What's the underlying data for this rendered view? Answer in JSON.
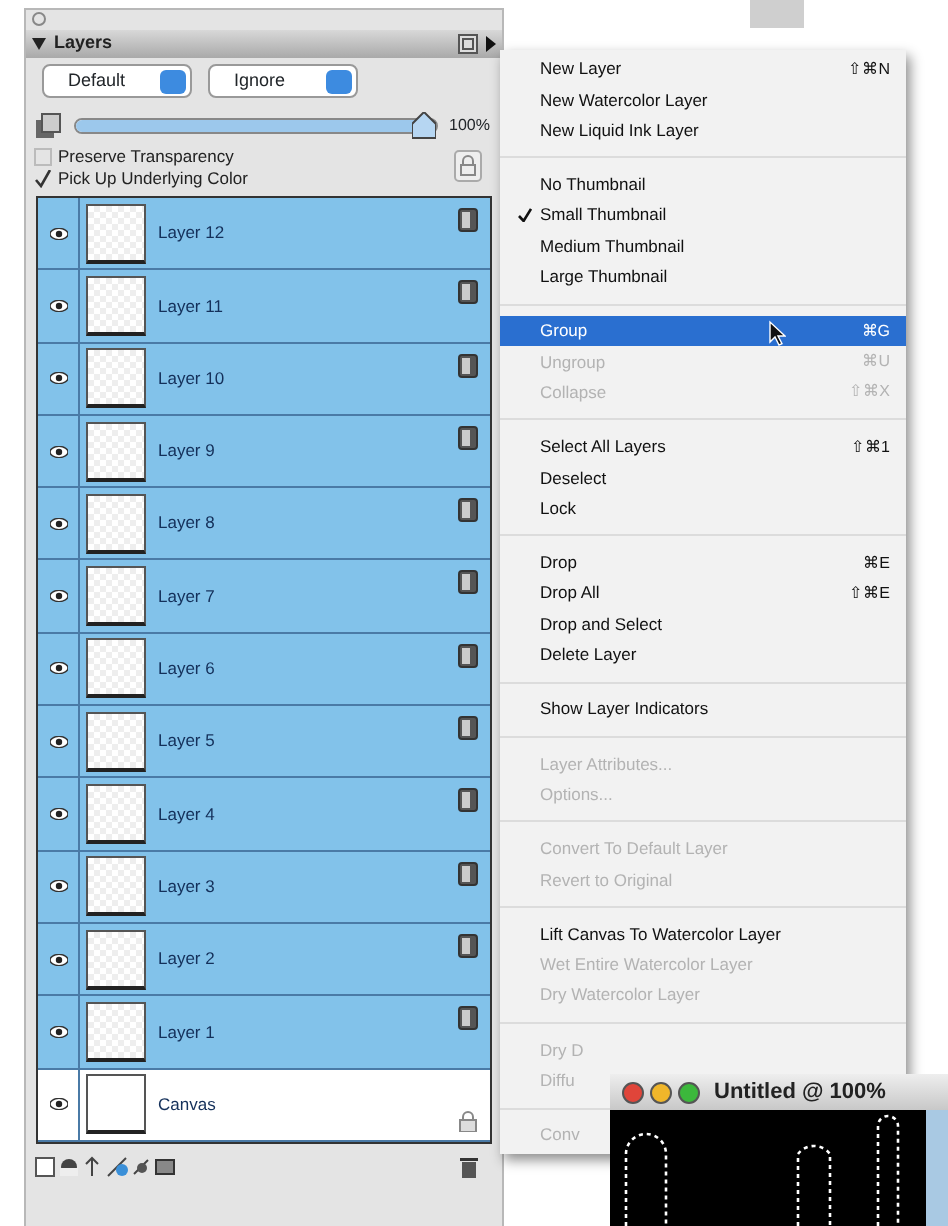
{
  "panel": {
    "title": "Layers",
    "composite_method": "Default",
    "depth": "Ignore",
    "opacity": {
      "level": 1,
      "reading": "100%"
    },
    "options": [
      {
        "label": "Preserve Transparency",
        "checked": false
      },
      {
        "label": "Pick Up Underlying Color",
        "checked": true
      }
    ],
    "layers": [
      {
        "name": "Layer 12",
        "kind": "layer",
        "selected": true,
        "visible": true
      },
      {
        "name": "Layer 11",
        "kind": "layer",
        "selected": true,
        "visible": true
      },
      {
        "name": "Layer 10",
        "kind": "layer",
        "selected": true,
        "visible": true
      },
      {
        "name": "Layer 9",
        "kind": "layer",
        "selected": true,
        "visible": true
      },
      {
        "name": "Layer 8",
        "kind": "layer",
        "selected": true,
        "visible": true
      },
      {
        "name": "Layer 7",
        "kind": "layer",
        "selected": true,
        "visible": true
      },
      {
        "name": "Layer 6",
        "kind": "layer",
        "selected": true,
        "visible": true
      },
      {
        "name": "Layer 5",
        "kind": "layer",
        "selected": true,
        "visible": true
      },
      {
        "name": "Layer 4",
        "kind": "layer",
        "selected": true,
        "visible": true
      },
      {
        "name": "Layer 3",
        "kind": "layer",
        "selected": true,
        "visible": true
      },
      {
        "name": "Layer 2",
        "kind": "layer",
        "selected": true,
        "visible": true
      },
      {
        "name": "Layer 1",
        "kind": "layer",
        "selected": true,
        "visible": true
      },
      {
        "name": "Canvas",
        "kind": "canvas",
        "selected": false,
        "visible": true
      }
    ]
  },
  "menu": {
    "groups": [
      [
        {
          "label": "New Layer",
          "shortcut": "⇧⌘N",
          "disabled": false,
          "checked": false,
          "selected": false
        },
        {
          "label": "New Watercolor Layer",
          "disabled": false,
          "checked": false,
          "selected": false
        },
        {
          "label": "New Liquid Ink Layer",
          "disabled": false,
          "checked": false,
          "selected": false
        }
      ],
      [
        {
          "label": "No Thumbnail",
          "disabled": false,
          "checked": false,
          "selected": false
        },
        {
          "label": "Small Thumbnail",
          "disabled": false,
          "checked": true,
          "selected": false
        },
        {
          "label": "Medium Thumbnail",
          "disabled": false,
          "checked": false,
          "selected": false
        },
        {
          "label": "Large Thumbnail",
          "disabled": false,
          "checked": false,
          "selected": false
        }
      ],
      [
        {
          "label": "Group",
          "shortcut": "⌘G",
          "disabled": false,
          "checked": false,
          "selected": true
        },
        {
          "label": "Ungroup",
          "shortcut": "⌘U",
          "disabled": true,
          "checked": false,
          "selected": false
        },
        {
          "label": "Collapse",
          "shortcut": "⇧⌘X",
          "disabled": true,
          "checked": false,
          "selected": false
        }
      ],
      [
        {
          "label": "Select All Layers",
          "shortcut": "⇧⌘1",
          "disabled": false,
          "checked": false,
          "selected": false
        },
        {
          "label": "Deselect",
          "disabled": false,
          "checked": false,
          "selected": false
        },
        {
          "label": "Lock",
          "disabled": false,
          "checked": false,
          "selected": false
        }
      ],
      [
        {
          "label": "Drop",
          "shortcut": "⌘E",
          "disabled": false,
          "checked": false,
          "selected": false
        },
        {
          "label": "Drop All",
          "shortcut": "⇧⌘E",
          "disabled": false,
          "checked": false,
          "selected": false
        },
        {
          "label": "Drop and Select",
          "disabled": false,
          "checked": false,
          "selected": false
        },
        {
          "label": "Delete Layer",
          "disabled": false,
          "checked": false,
          "selected": false
        }
      ],
      [
        {
          "label": "Show Layer Indicators",
          "disabled": false,
          "checked": false,
          "selected": false
        }
      ],
      [
        {
          "label": "Layer Attributes...",
          "disabled": true,
          "checked": false,
          "selected": false
        },
        {
          "label": "Options...",
          "disabled": true,
          "checked": false,
          "selected": false
        }
      ],
      [
        {
          "label": "Convert To Default Layer",
          "disabled": true,
          "checked": false,
          "selected": false
        },
        {
          "label": "Revert to Original",
          "disabled": true,
          "checked": false,
          "selected": false
        }
      ],
      [
        {
          "label": "Lift Canvas To Watercolor Layer",
          "disabled": false,
          "checked": false,
          "selected": false
        },
        {
          "label": "Wet Entire Watercolor Layer",
          "disabled": true,
          "checked": false,
          "selected": false
        },
        {
          "label": "Dry Watercolor Layer",
          "disabled": true,
          "checked": false,
          "selected": false
        }
      ],
      [
        {
          "label": "Dry D",
          "disabled": true,
          "checked": false,
          "selected": false
        },
        {
          "label": "Diffu",
          "disabled": true,
          "checked": false,
          "selected": false
        }
      ],
      [
        {
          "label": "Conv",
          "disabled": true,
          "checked": false,
          "selected": false
        }
      ]
    ]
  },
  "document_window": {
    "title": "Untitled @ 100%"
  }
}
